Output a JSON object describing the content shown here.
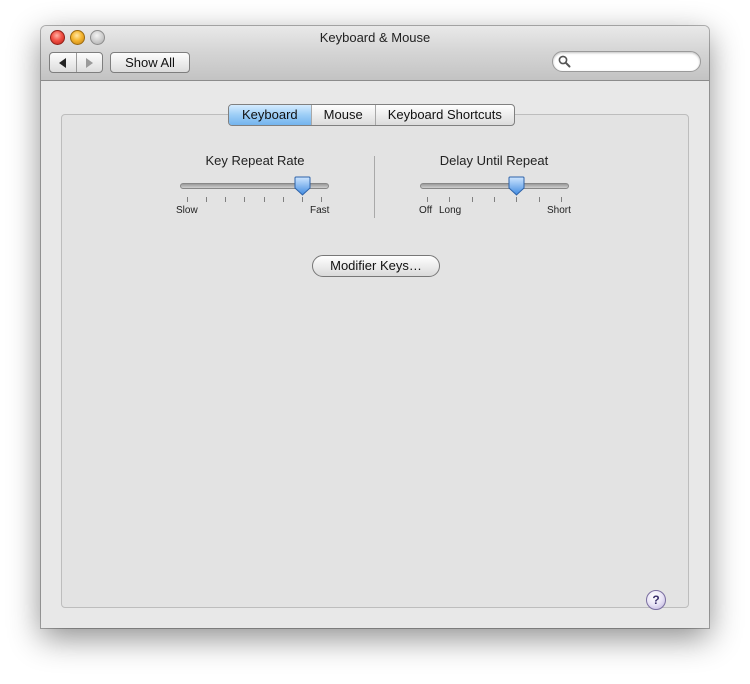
{
  "window": {
    "title": "Keyboard & Mouse"
  },
  "toolbar": {
    "show_all_label": "Show All",
    "back_icon": "back-arrow-icon",
    "forward_icon": "forward-arrow-icon",
    "search_placeholder": "",
    "search_value": ""
  },
  "tabs": [
    {
      "label": "Keyboard",
      "selected": true
    },
    {
      "label": "Mouse",
      "selected": false
    },
    {
      "label": "Keyboard Shortcuts",
      "selected": false
    }
  ],
  "key_repeat": {
    "label": "Key Repeat Rate",
    "min_label": "Slow",
    "max_label": "Fast",
    "tick_count": 8,
    "selected_step": 6
  },
  "delay_repeat": {
    "label": "Delay Until Repeat",
    "off_label": "Off",
    "min_label": "Long",
    "max_label": "Short",
    "tick_count": 7,
    "selected_step": 4
  },
  "modifier_button_label": "Modifier Keys…",
  "help_label": "?",
  "colors": {
    "selected_tab": "#9ccdf6",
    "slider_thumb": "#5aa0ea",
    "window_bg": "#e8e8e8"
  }
}
